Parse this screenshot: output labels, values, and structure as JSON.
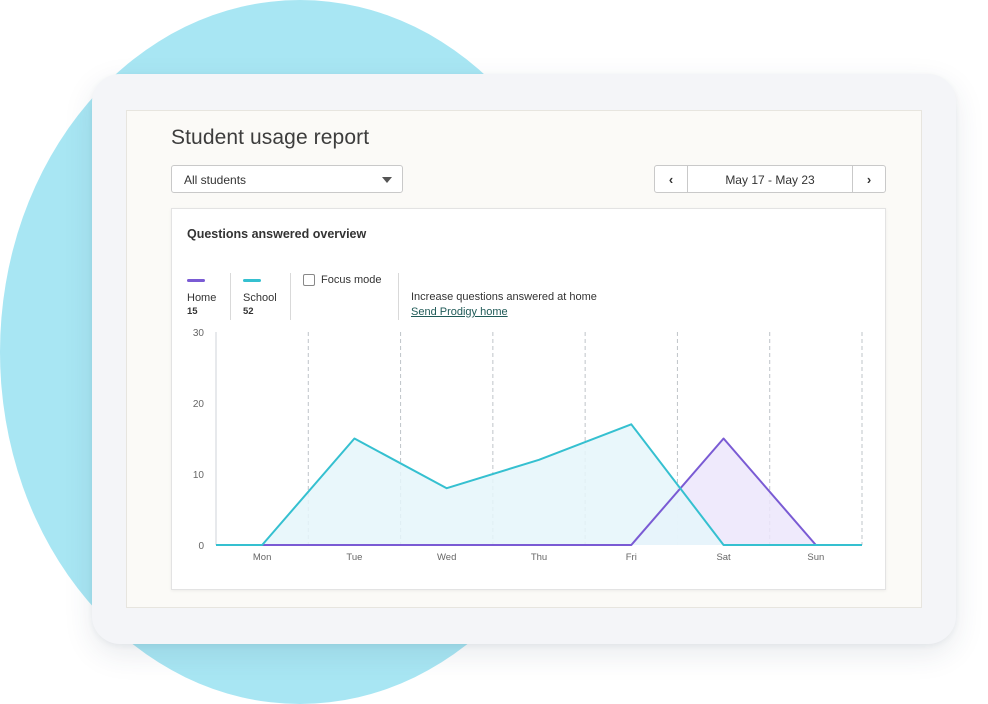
{
  "report": {
    "title": "Student usage report",
    "student_filter": {
      "selected": "All students"
    },
    "date_range": {
      "label": "May 17 - May 23"
    }
  },
  "card": {
    "title": "Questions answered overview",
    "focus_mode_label": "Focus mode",
    "focus_mode_checked": false,
    "promo_text": "Increase questions answered at home",
    "promo_link": "Send Prodigy home"
  },
  "legend": [
    {
      "name": "Home",
      "count": "15",
      "color": "#7a5bd4"
    },
    {
      "name": "School",
      "count": "52",
      "color": "#35c0d0"
    }
  ],
  "chart_data": {
    "type": "area",
    "categories": [
      "Mon",
      "Tue",
      "Wed",
      "Thu",
      "Fri",
      "Sat",
      "Sun"
    ],
    "x": [
      0,
      0.5,
      1.5,
      2.5,
      3.5,
      4.5,
      5.5,
      6.5,
      7
    ],
    "x_note_categories": "Mon",
    "series": [
      {
        "name": "Home",
        "color": "#7a5bd4",
        "fill": "#ece6fb",
        "values": [
          0,
          0,
          0,
          0,
          0,
          0,
          15,
          0,
          0
        ]
      },
      {
        "name": "School",
        "color": "#35c0d0",
        "fill": "#e5f6fa",
        "values": [
          0,
          0,
          15,
          8,
          12,
          17,
          0,
          0,
          0
        ]
      }
    ],
    "yticks": [
      "0",
      "10",
      "20",
      "30"
    ],
    "ylim": [
      0,
      30
    ],
    "grid": "vertical-dashed",
    "legend_position": "top-left"
  }
}
